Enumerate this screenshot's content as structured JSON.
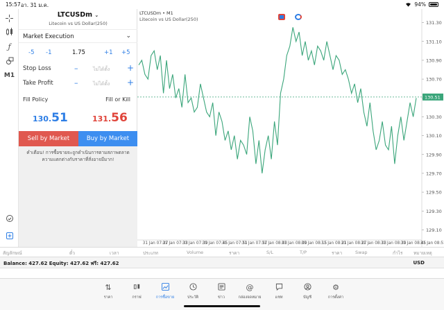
{
  "status_bar": {
    "time": "15:57",
    "date": "อา. 31 ม.ค.",
    "battery": "94%"
  },
  "toolstrip": {
    "timeframe": "M1",
    "icons": [
      "crosshair-icon",
      "indicators-icon",
      "function-icon",
      "objects-icon",
      "timeframe-label",
      "history-icon",
      "chart-export-icon"
    ]
  },
  "order": {
    "symbol": "LTCUSDm",
    "description": "Litecoin vs US Dollar(250)",
    "execution": "Market Execution",
    "volume": {
      "minus5": "-5",
      "minus1": "-1",
      "value": "1.75",
      "plus1": "+1",
      "plus5": "+5"
    },
    "stop_loss": {
      "label": "Stop Loss",
      "placeholder": "ไม่ได้ตั้ง"
    },
    "take_profit": {
      "label": "Take Profit",
      "placeholder": "ไม่ได้ตั้ง"
    },
    "fill_policy": {
      "label": "Fill Policy",
      "value": "Fill or Kill"
    },
    "sell_price": {
      "prefix": "130.",
      "suffix": "51"
    },
    "buy_price": {
      "prefix": "131.",
      "suffix": "56"
    },
    "sell_label": "Sell by Market",
    "buy_label": "Buy by Market",
    "warning": "คำเตือน! การซื้อขายจะถูกดำเนินการตามสภาพตลาด ความแตกต่างกับราคาที่สั่งอาจมีมาก!"
  },
  "chart": {
    "title": "LTCUSDm • M1",
    "subtitle": "Litecoin vs US Dollar(250)",
    "line_color": "#3aa57a",
    "bid_color": "#3aa57a",
    "bid_label": "130.51",
    "y_ticks": [
      "131.30",
      "131.10",
      "130.90",
      "130.70",
      "130.50",
      "130.30",
      "130.10",
      "129.90",
      "129.70",
      "129.50",
      "129.30",
      "129.10"
    ],
    "x_ticks": [
      "31 Jan 07:27",
      "31 Jan 07:33",
      "31 Jan 07:39",
      "31 Jan 07:45",
      "31 Jan 07:51",
      "31 Jan 07:57",
      "31 Jan 08:03",
      "31 Jan 08:09",
      "31 Jan 08:15",
      "31 Jan 08:21",
      "31 Jan 08:27",
      "31 Jan 08:33",
      "31 Jan 08:39",
      "31 Jan 08:45",
      "31 Jan 08:51"
    ]
  },
  "chart_data": {
    "type": "line",
    "title": "LTCUSDm • M1",
    "xlabel": "",
    "ylabel": "",
    "ylim": [
      129.0,
      131.4
    ],
    "bid": 130.51,
    "series": [
      {
        "values": [
          130.85,
          130.9,
          130.75,
          130.7,
          130.95,
          131.0,
          130.8,
          130.95,
          130.55,
          130.9,
          130.6,
          130.75,
          130.5,
          130.6,
          130.4,
          130.75,
          130.45,
          130.5,
          130.35,
          130.4,
          130.65,
          130.5,
          130.35,
          130.3,
          130.45,
          130.1,
          130.35,
          130.25,
          130.05,
          130.15,
          129.95,
          130.1,
          129.85,
          130.05,
          130.0,
          129.9,
          130.3,
          130.15,
          129.8,
          130.05,
          129.7,
          129.95,
          130.1,
          129.85,
          130.25,
          130.0,
          130.55,
          130.7,
          130.95,
          131.05,
          131.25,
          131.1,
          131.2,
          130.95,
          131.1,
          130.9,
          131.0,
          130.85,
          131.05,
          131.0,
          130.9,
          131.1,
          130.95,
          130.8,
          130.95,
          130.9,
          130.75,
          130.8,
          130.7,
          130.55,
          130.65,
          130.45,
          130.6,
          130.35,
          130.2,
          130.45,
          130.15,
          129.95,
          130.05,
          130.25,
          130.0,
          129.95,
          130.2,
          129.8,
          130.1,
          130.3,
          130.05,
          130.25,
          130.45,
          130.3,
          130.5
        ]
      }
    ]
  },
  "trade_table": {
    "headers": [
      "สัญลักษณ์",
      "ตั๋ว",
      "เวลา",
      "ประเภท",
      "Volume",
      "ราคา",
      "S/L",
      "T/P",
      "ราคา",
      "Swap",
      "กำไร",
      "หมายเหตุ"
    ]
  },
  "balance": {
    "text": "Balance: 427.62 Equity: 427.62 ฟรี: 427.62",
    "currency": "USD"
  },
  "bottom_nav": [
    {
      "label": "ราคา",
      "icon": "quotes-icon"
    },
    {
      "label": "กราฟ",
      "icon": "chart-icon"
    },
    {
      "label": "การซื้อขาย",
      "icon": "trade-icon",
      "active": true
    },
    {
      "label": "ประวัติ",
      "icon": "history-icon"
    },
    {
      "label": "ข่าว",
      "icon": "news-icon"
    },
    {
      "label": "กล่องจดหมาย",
      "icon": "mailbox-icon"
    },
    {
      "label": "แชท",
      "icon": "chat-icon"
    },
    {
      "label": "บัญชี",
      "icon": "account-icon"
    },
    {
      "label": "การตั้งค่า",
      "icon": "settings-icon"
    }
  ]
}
